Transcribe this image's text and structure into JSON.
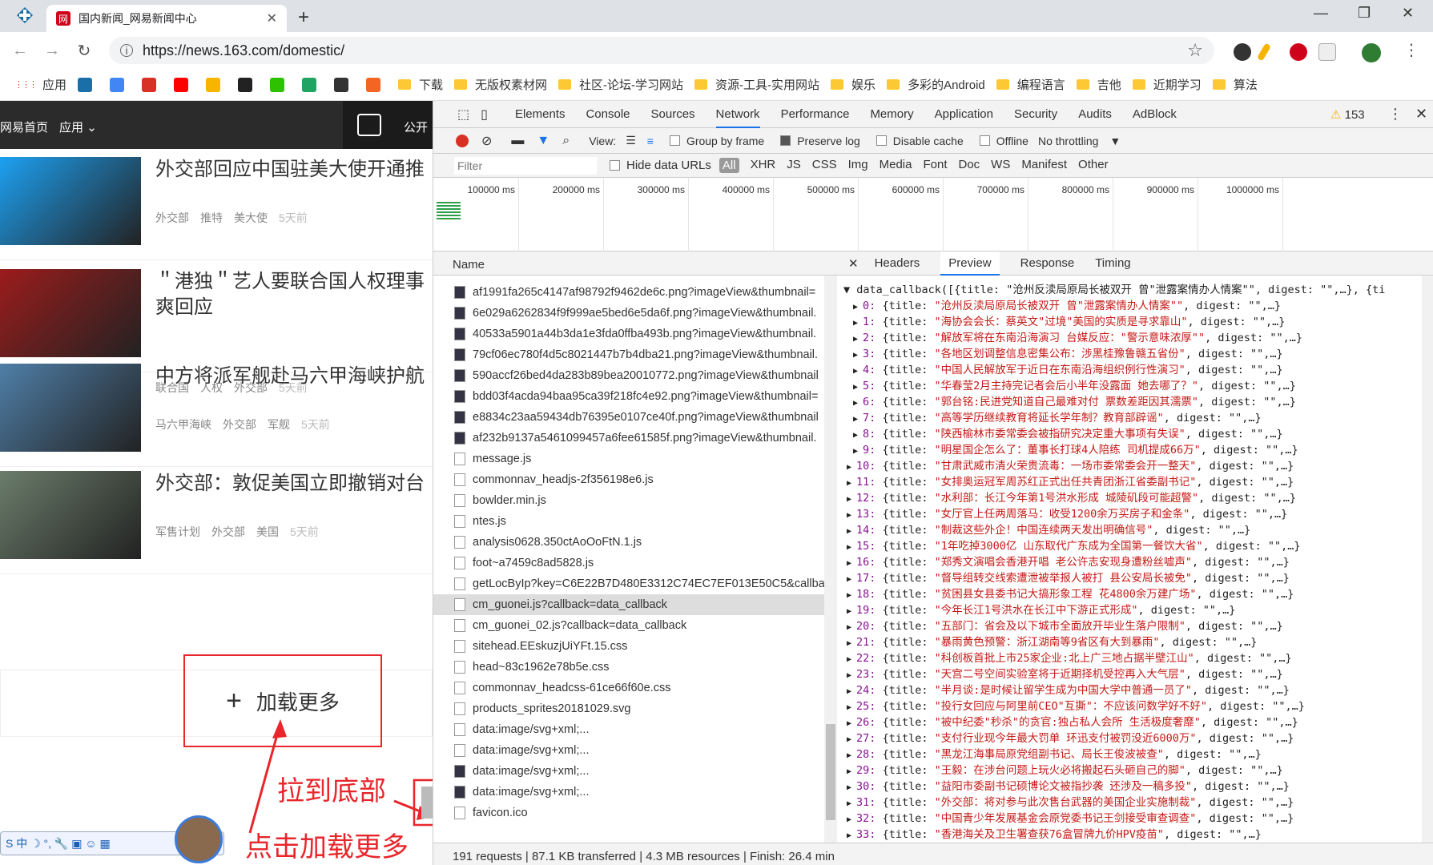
{
  "browser": {
    "tab_title": "国内新闻_网易新闻中心",
    "tab_favicon": "网",
    "new_tab_glyph": "+",
    "url": "https://news.163.com/domestic/",
    "minimize": "—",
    "maximize": "❐",
    "close": "✕",
    "bookmarks": [
      {
        "label": "应用",
        "kind": "apps-icon"
      },
      {
        "label": "",
        "kind": "site-icon",
        "color": "#1b6fa8"
      },
      {
        "label": "",
        "kind": "google-icon",
        "color": "#4285f4"
      },
      {
        "label": "",
        "kind": "gmail-icon",
        "color": "#d93025"
      },
      {
        "label": "",
        "kind": "youtube-icon",
        "color": "#ff0000"
      },
      {
        "label": "",
        "kind": "duck-icon",
        "color": "#f7b500"
      },
      {
        "label": "",
        "kind": "github-icon",
        "color": "#222222"
      },
      {
        "label": "",
        "kind": "wechat-icon",
        "color": "#2dc100"
      },
      {
        "label": "",
        "kind": "drive-icon",
        "color": "#1fa463"
      },
      {
        "label": "",
        "kind": "face-icon",
        "color": "#333333"
      },
      {
        "label": "",
        "kind": "y-icon",
        "color": "#f26522"
      },
      {
        "label": "下载",
        "kind": "folder"
      },
      {
        "label": "无版权素材网",
        "kind": "folder"
      },
      {
        "label": "社区-论坛-学习网站",
        "kind": "folder"
      },
      {
        "label": "资源-工具-实用网站",
        "kind": "folder"
      },
      {
        "label": "娱乐",
        "kind": "folder"
      },
      {
        "label": "多彩的Android",
        "kind": "folder"
      },
      {
        "label": "编程语言",
        "kind": "folder"
      },
      {
        "label": "吉他",
        "kind": "folder"
      },
      {
        "label": "近期学习",
        "kind": "folder"
      },
      {
        "label": "算法",
        "kind": "folder"
      }
    ]
  },
  "site": {
    "nav_home": "网易首页",
    "nav_apps": "应用",
    "nav_right": "公开",
    "news": [
      {
        "title": "外交部回应中国驻美大使开通推",
        "tags": [
          "外交部",
          "推特",
          "美大使"
        ],
        "time": "5天前",
        "thumb_color": "#1da1f2"
      },
      {
        "title": "＂港独＂艺人要联合国人权理事 爽回应",
        "tags": [
          "联合国",
          "人权",
          "外交部"
        ],
        "time": "5天前",
        "thumb_color": "#9b1c1c"
      },
      {
        "title": "中方将派军舰赴马六甲海峡护航",
        "tags": [
          "马六甲海峡",
          "外交部",
          "军舰"
        ],
        "time": "5天前",
        "thumb_color": "#4f7fa8"
      },
      {
        "title": "外交部：敦促美国立即撤销对台",
        "tags": [
          "军售计划",
          "外交部",
          "美国"
        ],
        "time": "5天前",
        "thumb_color": "#6b7d6b"
      }
    ],
    "load_more": "加载更多",
    "load_more_plus": "+",
    "annotation_1": "拉到底部",
    "annotation_2": "点击加载更多"
  },
  "devtools": {
    "tabs": [
      "Elements",
      "Console",
      "Sources",
      "Network",
      "Performance",
      "Memory",
      "Application",
      "Security",
      "Audits",
      "AdBlock"
    ],
    "active_tab": "Network",
    "warnings": "153",
    "view_label": "View:",
    "group_by_frame": "Group by frame",
    "preserve_log": "Preserve log",
    "disable_cache": "Disable cache",
    "offline": "Offline",
    "throttling": "No throttling",
    "filter_placeholder": "Filter",
    "hide_data_urls": "Hide data URLs",
    "filters": [
      "All",
      "XHR",
      "JS",
      "CSS",
      "Img",
      "Media",
      "Font",
      "Doc",
      "WS",
      "Manifest",
      "Other"
    ],
    "timeline_ticks": [
      "100000 ms",
      "200000 ms",
      "300000 ms",
      "400000 ms",
      "500000 ms",
      "600000 ms",
      "700000 ms",
      "800000 ms",
      "900000 ms",
      "1000000 ms"
    ],
    "name_header": "Name",
    "requests": [
      {
        "name": "af1991fa265c4147af98792f9462de6c.png?imageView&thumbnail=",
        "type": "img"
      },
      {
        "name": "6e029a6262834f9f999ae5bed6e5da6f.png?imageView&thumbnail.",
        "type": "img"
      },
      {
        "name": "40533a5901a44b3da1e3fda0ffba493b.png?imageView&thumbnail.",
        "type": "img"
      },
      {
        "name": "79cf06ec780f4d5c8021447b7b4dba21.png?imageView&thumbnail.",
        "type": "img"
      },
      {
        "name": "590accf26bed4da283b89bea20010772.png?imageView&thumbnail",
        "type": "img"
      },
      {
        "name": "bdd03f4acda94baa95ca39f218fc4e92.png?imageView&thumbnail=",
        "type": "img"
      },
      {
        "name": "e8834c23aa59434db76395e0107ce40f.png?imageView&thumbnail",
        "type": "img"
      },
      {
        "name": "af232b9137a5461099457a6fee61585f.png?imageView&thumbnail.",
        "type": "img"
      },
      {
        "name": "message.js",
        "type": "doc"
      },
      {
        "name": "commonnav_headjs-2f356198e6.js",
        "type": "doc"
      },
      {
        "name": "bowlder.min.js",
        "type": "doc"
      },
      {
        "name": "ntes.js",
        "type": "doc"
      },
      {
        "name": "analysis0628.350ctAoOoFtN.1.js",
        "type": "doc"
      },
      {
        "name": "foot~a7459c8ad5828.js",
        "type": "doc"
      },
      {
        "name": "getLocByIp?key=C6E22B7D480E3312C74EC7EF013E50C5&callback",
        "type": "doc"
      },
      {
        "name": "cm_guonei.js?callback=data_callback",
        "type": "doc",
        "selected": true
      },
      {
        "name": "cm_guonei_02.js?callback=data_callback",
        "type": "doc"
      },
      {
        "name": "sitehead.EEskuzjUiYFt.15.css",
        "type": "doc"
      },
      {
        "name": "head~83c1962e78b5e.css",
        "type": "doc"
      },
      {
        "name": "commonnav_headcss-61ce66f60e.css",
        "type": "doc"
      },
      {
        "name": "products_sprites20181029.svg",
        "type": "doc"
      },
      {
        "name": "data:image/svg+xml;...",
        "type": "doc"
      },
      {
        "name": "data:image/svg+xml;...",
        "type": "doc"
      },
      {
        "name": "data:image/svg+xml;...",
        "type": "img"
      },
      {
        "name": "data:image/svg+xml;...",
        "type": "img"
      },
      {
        "name": "favicon.ico",
        "type": "doc"
      }
    ],
    "status": "191 requests  |  87.1 KB transferred  |  4.3 MB resources  |  Finish: 26.4 min",
    "detail_tabs": [
      "Headers",
      "Preview",
      "Response",
      "Timing"
    ],
    "detail_active": "Preview",
    "preview_head": "▼ data_callback([{title: \"沧州反渎局原局长被双开 曾\"泄露案情办人情案\"\", digest: \"\",…}, {ti",
    "preview_items": [
      "沧州反渎局原局长被双开 曾\"泄露案情办人情案\"",
      "海协会会长：蔡英文\"过境\"美国的实质是寻求靠山",
      "解放军将在东南沿海演习 台媒反应：\"警示意味浓厚\"",
      "各地区划调整信息密集公布：涉黑桂豫鲁赣五省份",
      "中国人民解放军于近日在东南沿海组织例行性演习",
      "华春莹2月主持完记者会后小半年没露面 她去哪了？",
      "郭台铭:民进党知道自己最难对付 票数差距因其濡票",
      "高等学历继续教育将延长学年制？教育部辟谣",
      "陕西榆林市委常委会被指研究决定重大事项有失误",
      "明星国企怎么了：董事长打球4人陪练 司机提成66万",
      "甘肃武威市清火荣贵流毒：一场市委常委会开一整天",
      "女排奥运冠军周苏红正式出任共青团浙江省委副书记",
      "水利部：长江今年第1号洪水形成 城陵矶段可能超警",
      "女厅官上任两周落马：收受1200余万买房子和金条",
      "制裁这些外企！中国连续两天发出明确信号",
      "1年吃掉3000亿 山东取代广东成为全国第一餐饮大省",
      "郑秀文演唱会香港开唱 老公许志安现身遭粉丝嘘声",
      "督导组转交线索遭泄被举报人被打 县公安局长被免",
      "贫困县女县委书记大搞形象工程 花4800余万建广场",
      "今年长江1号洪水在长江中下游正式形成",
      "五部门：省会及以下城市全面放开毕业生落户限制",
      "暴雨黄色预警：浙江湖南等9省区有大到暴雨",
      "科创板首批上市25家企业:北上广三地占据半壁江山",
      "天宫二号空间实验室将于近期择机受控再入大气层",
      "半月谈:是时候让留学生成为中国大学中普通一员了",
      "投行女回应与阿里前CEO\"互撕\"：不应该问数学好不好",
      "被中纪委\"秒杀\"的贪官:独占私人会所 生活极度奢靡",
      "支付行业现今年最大罚单 环迅支付被罚没近6000万",
      "黑龙江海事局原党组副书记、局长王俊波被查",
      "王毅：在涉台问题上玩火必将搬起石头砸自己的脚",
      "益阳市委副书记硕博论文被指抄袭 还涉及一稿多投",
      "外交部：将对参与此次售台武器的美国企业实施制裁",
      "中国青少年发展基金会原党委书记王剑接受审查调查",
      "香港海关及卫生署查获76盒冒牌九价HPV疫苗"
    ]
  }
}
